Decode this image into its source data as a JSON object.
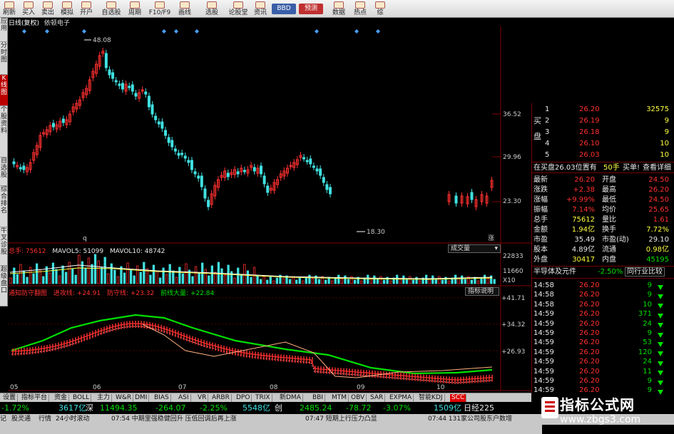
{
  "toolbar": {
    "buttons": [
      "刷新",
      "买入",
      "卖出",
      "模拟",
      "开户",
      "自选股",
      "周期",
      "F10/F9",
      "画线",
      "选股",
      "论股堂",
      "资讯"
    ],
    "bbd": "BBD",
    "forecast": "预测",
    "data": "数据",
    "hot": "热点",
    "comp": "综"
  },
  "left_tabs": [
    "应用",
    "分时图",
    "K线图",
    "个股资料",
    "自选股",
    "综合排名",
    "牛叉诊股",
    "超级盘口"
  ],
  "title": {
    "period": "日线(复权)",
    "stock": "依顿电子"
  },
  "price_axis": [
    "36.52",
    "29.96",
    "23.30"
  ],
  "annotations": {
    "high": "48.08",
    "low": "18.30",
    "date_marker": "q",
    "rise_marker": "涨"
  },
  "volume_panel": {
    "total": "总手: 75612",
    "ma5": "MAVOL5: 51099",
    "ma10": "MAVOL10: 48742",
    "tag": "成交量",
    "axis": [
      "22833",
      "11660",
      "X10"
    ]
  },
  "indicator_panel": {
    "name": "通知防守翻图",
    "attack": "进攻线: +24.91",
    "defend": "防守线: +23.32",
    "front": "前线大量: +22.84",
    "tag": "指标说明",
    "axis": [
      "+41.71",
      "+34.32",
      "+26.93"
    ]
  },
  "date_axis": [
    "05",
    "06",
    "07",
    "08",
    "09",
    "10"
  ],
  "quote": {
    "side_labels": [
      "买",
      "盘"
    ],
    "bids": [
      {
        "level": "1",
        "price": "26.20",
        "vol": "32575"
      },
      {
        "level": "2",
        "price": "26.19",
        "vol": "9"
      },
      {
        "level": "3",
        "price": "26.18",
        "vol": "9"
      },
      {
        "level": "4",
        "price": "26.10",
        "vol": "10"
      },
      {
        "level": "5",
        "price": "26.03",
        "vol": "10"
      }
    ],
    "position_line": "在买盘26.03位置有",
    "position_vol": "50手",
    "buy_one": "买单!",
    "detail": "查看详细",
    "stats": [
      {
        "l1": "最新",
        "v1": "26.20",
        "l2": "开盘",
        "v2": "24.50"
      },
      {
        "l1": "涨跌",
        "v1": "+2.38",
        "l2": "最高",
        "v2": "26.20"
      },
      {
        "l1": "涨幅",
        "v1": "+9.99%",
        "l2": "最低",
        "v2": "24.50"
      },
      {
        "l1": "振幅",
        "v1": "7.14%",
        "l2": "均价",
        "v2": "25.65"
      },
      {
        "l1": "总手",
        "v1": "75612",
        "l2": "量比",
        "v2": "1.61"
      },
      {
        "l1": "金额",
        "v1": "1.94亿",
        "l2": "换手",
        "v2": "7.72%"
      },
      {
        "l1": "市盈",
        "v1": "35.49",
        "l2": "市盈(动)",
        "v2": "29.10"
      },
      {
        "l1": "股本",
        "v1": "4.89亿",
        "l2": "流通",
        "v2": "0.98亿"
      },
      {
        "l1": "外盘",
        "v1": "30417",
        "l2": "内盘",
        "v2": "45195"
      }
    ],
    "sector": "半导体及元件",
    "sector_pct": "-2.50%",
    "compare": "同行业比较",
    "ticks": [
      {
        "time": "14:58",
        "price": "26.20",
        "vol": "9"
      },
      {
        "time": "14:58",
        "price": "26.20",
        "vol": "9"
      },
      {
        "time": "14:58",
        "price": "26.20",
        "vol": "10"
      },
      {
        "time": "14:59",
        "price": "26.20",
        "vol": "371"
      },
      {
        "time": "14:59",
        "price": "26.20",
        "vol": "24"
      },
      {
        "time": "14:59",
        "price": "26.20",
        "vol": "9"
      },
      {
        "time": "14:59",
        "price": "26.20",
        "vol": "53"
      },
      {
        "time": "14:59",
        "price": "26.20",
        "vol": "120"
      },
      {
        "time": "14:59",
        "price": "26.20",
        "vol": "24"
      },
      {
        "time": "14:59",
        "price": "26.20",
        "vol": "11"
      },
      {
        "time": "14:59",
        "price": "26.20",
        "vol": "9"
      },
      {
        "time": "14:59",
        "price": "26.20",
        "vol": "9"
      }
    ]
  },
  "indicator_tabs": [
    "设置",
    "指标平台",
    "资金",
    "BOLL",
    "主力",
    "W&R",
    "DMI",
    "BIAS",
    "ASI",
    "VR",
    "ARBR",
    "DPO",
    "TRIX",
    "新DMA",
    "BBI",
    "MTM",
    "OBV",
    "SAR",
    "EXPMA",
    "智能KDJ",
    "SCC"
  ],
  "market": {
    "sh_pct": "-1.72%",
    "sh_amt": "3617亿",
    "sh_label": "深",
    "sz_val": "11494.35",
    "sz_chg": "-264.07",
    "sz_pct": "-2.25%",
    "cy_amt": "5548亿",
    "cy_label": "创",
    "cy_val": "2485.24",
    "cy_chg": "-78.72",
    "cy_pct": "-3.07%",
    "extra_amt": "1509亿",
    "extra_label": "日经225"
  },
  "news": {
    "tabs": [
      "记",
      "股灵通",
      "行情",
      "24小时滚动"
    ],
    "items": [
      "07:54 中期里强稳健回升 压低回调后再上涨",
      "07:47 短期上行压力凸显",
      "07:44 131家公司股东户数增"
    ]
  },
  "watermark": {
    "title": "指标公式网",
    "url": "www.zbgs3.com"
  },
  "colors": {
    "up": "#ff3030",
    "down": "#40e0e0",
    "ma_white": "#ffffff",
    "ma_yellow": "#ffff40",
    "ma_green": "#00e000",
    "frame": "#800000"
  }
}
